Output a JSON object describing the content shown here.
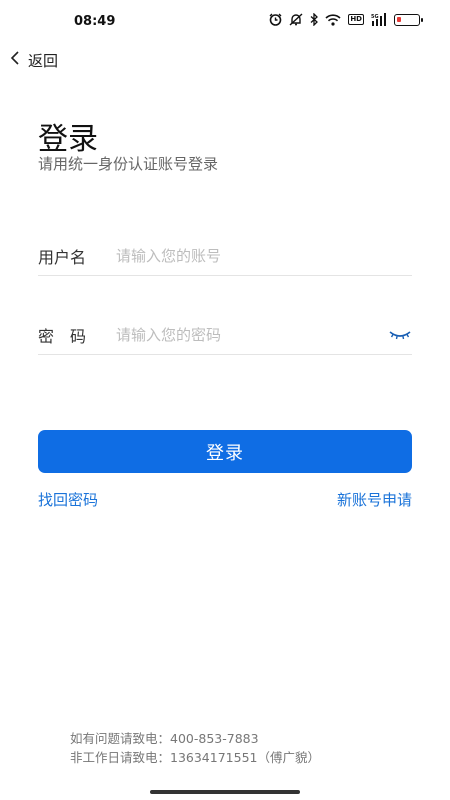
{
  "status_bar": {
    "time": "08:49",
    "icons": [
      "alarm-icon",
      "mute-icon",
      "bluetooth-icon",
      "wifi-icon",
      "hd-badge",
      "signal-icon",
      "battery-icon"
    ],
    "hd_label": "HD",
    "signal_label": "5G",
    "battery_level": 0.2,
    "battery_color": "#e53935"
  },
  "nav": {
    "back_label": "返回",
    "back_icon": "chevron-left-icon"
  },
  "header": {
    "title": "登录",
    "subtitle": "请用统一身份认证账号登录"
  },
  "form": {
    "username": {
      "label": "用户名",
      "placeholder": "请输入您的账号",
      "value": ""
    },
    "password": {
      "label": "密　码",
      "placeholder": "请输入您的密码",
      "value": "",
      "toggle_icon": "eye-closed-icon"
    },
    "submit_label": "登录"
  },
  "links": {
    "forgot_password": "找回密码",
    "new_account": "新账号申请"
  },
  "footer": {
    "line1": "如有问题请致电：400-853-7883",
    "line2": "非工作日请致电：13634171551（傅广貌）"
  },
  "colors": {
    "primary": "#0f6de4",
    "link": "#1a73d9"
  }
}
